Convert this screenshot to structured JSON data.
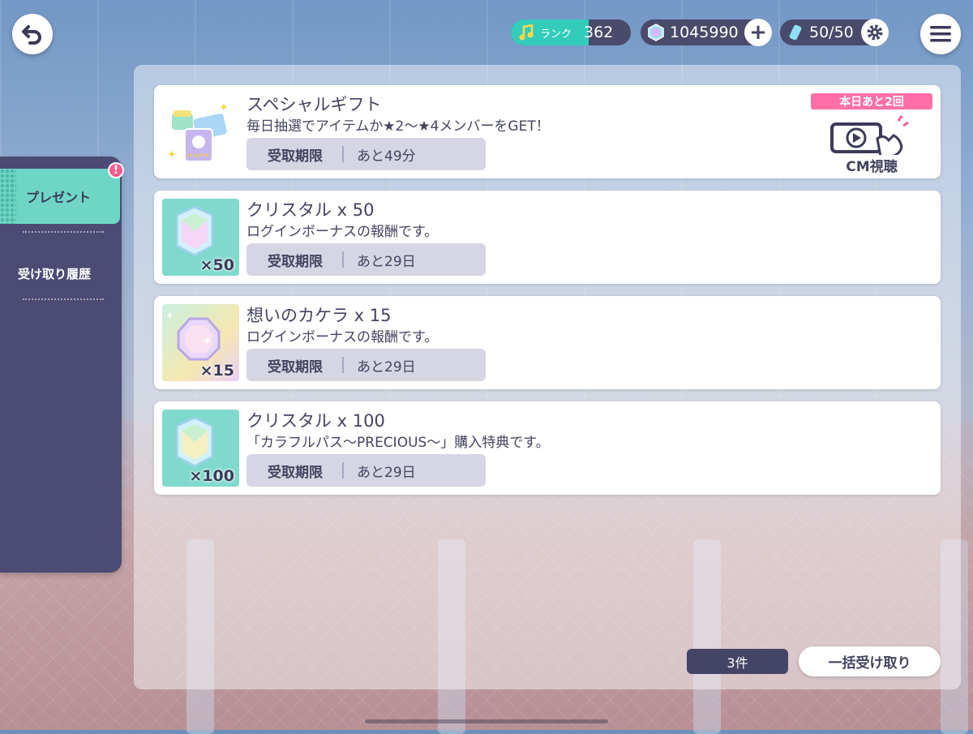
{
  "status": {
    "rank_label": "ランク",
    "rank_value": "362",
    "crystals": "1045990",
    "stamina": "50/50"
  },
  "tabs": {
    "present": "プレゼント",
    "history": "受け取り履歴",
    "alert": "!"
  },
  "special": {
    "title": "スペシャルギフト",
    "desc": "毎日抽選でアイテムか★2～★4メンバーをGET！",
    "deadline_label": "受取期限",
    "deadline_value": "あと49分",
    "cm_badge": "本日あと2回",
    "cm_label": "CM視聴"
  },
  "items": [
    {
      "title": "クリスタル x 50",
      "desc": "ログインボーナスの報酬です。",
      "deadline_label": "受取期限",
      "deadline_value": "あと29日",
      "qty": "×50",
      "icon": "crystal-icon"
    },
    {
      "title": "想いのカケラ x 15",
      "desc": "ログインボーナスの報酬です。",
      "deadline_label": "受取期限",
      "deadline_value": "あと29日",
      "qty": "×15",
      "icon": "gem-icon"
    },
    {
      "title": "クリスタル x 100",
      "desc": "「カラフルパス～PRECIOUS～」購入特典です。",
      "deadline_label": "受取期限",
      "deadline_value": "あと29日",
      "qty": "×100",
      "icon": "crystal-icon"
    }
  ],
  "footer": {
    "count": "3件",
    "bulk_receive": "一括受け取り"
  },
  "colors": {
    "accent": "#6fd6c7",
    "panel_dark": "#4c4b73",
    "pink": "#ff6fa5"
  }
}
